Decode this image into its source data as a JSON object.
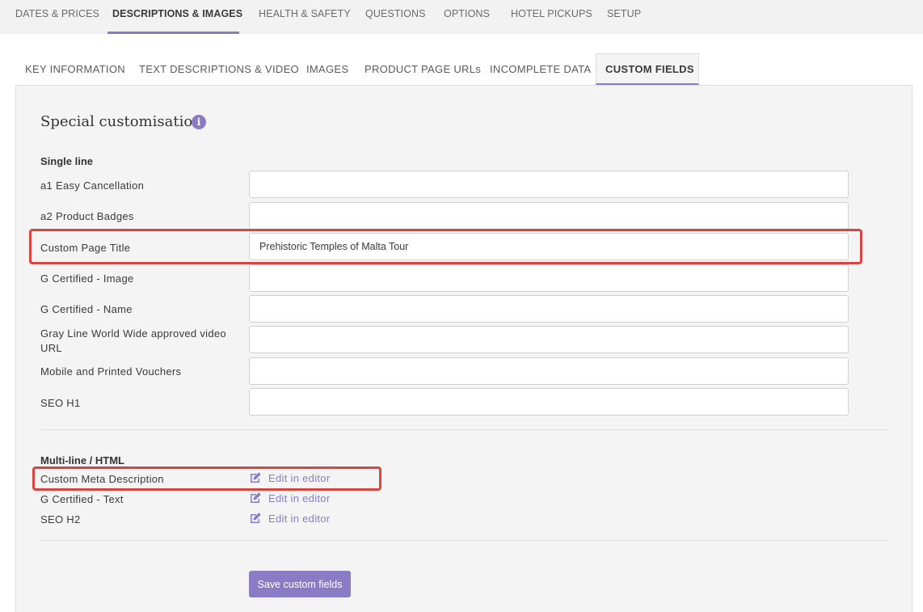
{
  "top_tabs": {
    "items": [
      {
        "label": "DATES & PRICES"
      },
      {
        "label": "DESCRIPTIONS & IMAGES"
      },
      {
        "label": "HEALTH & SAFETY"
      },
      {
        "label": "QUESTIONS"
      },
      {
        "label": "OPTIONS"
      },
      {
        "label": "HOTEL PICKUPS"
      },
      {
        "label": "SETUP"
      }
    ],
    "active": "DESCRIPTIONS & IMAGES"
  },
  "sub_tabs": {
    "items": [
      {
        "label": "KEY INFORMATION"
      },
      {
        "label": "TEXT DESCRIPTIONS & VIDEO"
      },
      {
        "label": "IMAGES"
      },
      {
        "label": "PRODUCT PAGE URLs"
      },
      {
        "label": "INCOMPLETE DATA"
      },
      {
        "label": "CUSTOM FIELDS"
      }
    ],
    "active": "CUSTOM FIELDS"
  },
  "section": {
    "title": "Special customisation",
    "info_icon": "info-icon",
    "info_glyph": "i"
  },
  "single_line": {
    "heading": "Single line",
    "fields": [
      {
        "label": "a1 Easy Cancellation",
        "value": ""
      },
      {
        "label": "a2 Product Badges",
        "value": ""
      },
      {
        "label": "Custom Page Title",
        "value": "Prehistoric Temples of Malta Tour",
        "highlighted": true
      },
      {
        "label": "G Certified - Image",
        "value": ""
      },
      {
        "label": "G Certified - Name",
        "value": ""
      },
      {
        "label": "Gray Line World Wide approved video URL",
        "value": ""
      },
      {
        "label": "Mobile and Printed Vouchers",
        "value": ""
      },
      {
        "label": "SEO H1",
        "value": ""
      }
    ]
  },
  "multi_line": {
    "heading": "Multi-line / HTML",
    "fields": [
      {
        "label": "Custom Meta Description",
        "link": "Edit in editor",
        "highlighted": true
      },
      {
        "label": "G Certified - Text",
        "link": "Edit in editor"
      },
      {
        "label": "SEO H2",
        "link": "Edit in editor"
      }
    ]
  },
  "actions": {
    "save_label": "Save custom fields"
  },
  "colors": {
    "accent": "#8a7cc4",
    "highlight": "#d9443c",
    "panel_bg": "#f4f4f4"
  }
}
